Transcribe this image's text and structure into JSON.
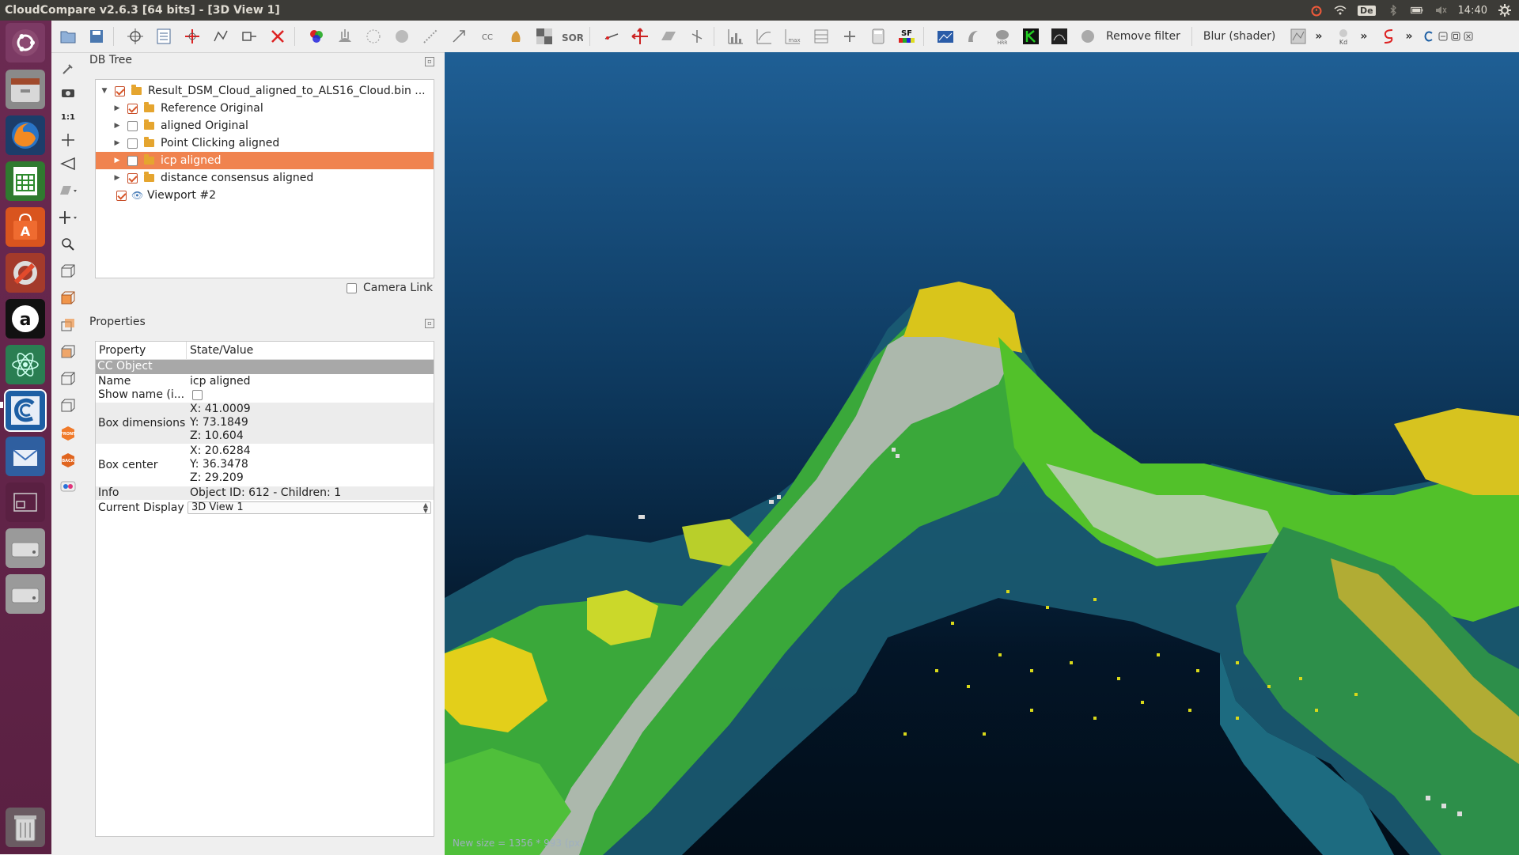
{
  "window": {
    "title": "CloudCompare v2.6.3 [64 bits] - [3D View 1]"
  },
  "system_tray": {
    "keyboard": "De",
    "time": "14:40"
  },
  "launcher": {
    "items": [
      "ubuntu-dash",
      "files",
      "firefox",
      "libreoffice-calc",
      "software-center",
      "system-settings",
      "amazon",
      "atom",
      "cloudcompare",
      "thunderbird",
      "workspaces",
      "drive-1",
      "drive-2",
      "trash"
    ]
  },
  "toolbar": {
    "remove_filter": "Remove filter",
    "blur_shader": "Blur (shader)",
    "more": "»",
    "sf_label": "SF",
    "sor_label": "SOR",
    "kd_label": "Kd"
  },
  "dbtree": {
    "title": "DB Tree",
    "items": [
      {
        "label": "Result_DSM_Cloud_aligned_to_ALS16_Cloud.bin ...",
        "checked": true,
        "level": 0,
        "expanded": true,
        "icon": "folder-icon"
      },
      {
        "label": "Reference Original",
        "checked": true,
        "level": 1,
        "icon": "folder-icon"
      },
      {
        "label": "aligned Original",
        "checked": false,
        "level": 1,
        "icon": "folder-icon"
      },
      {
        "label": "Point Clicking aligned",
        "checked": false,
        "level": 1,
        "icon": "folder-icon"
      },
      {
        "label": "icp aligned",
        "checked": false,
        "level": 1,
        "icon": "folder-icon",
        "selected": true
      },
      {
        "label": "distance consensus aligned",
        "checked": true,
        "level": 1,
        "icon": "folder-icon"
      },
      {
        "label": "Viewport #2",
        "checked": true,
        "level": 0,
        "icon": "eye-icon"
      }
    ],
    "camera_link": "Camera Link"
  },
  "properties": {
    "title": "Properties",
    "col_property": "Property",
    "col_value": "State/Value",
    "section": "CC Object",
    "name_key": "Name",
    "name_val": "icp aligned",
    "show_name_key": "Show name (i...",
    "box_dim_key": "Box dimensions",
    "box_dim": {
      "x": "X: 41.0009",
      "y": "Y: 73.1849",
      "z": "Z: 10.604"
    },
    "box_center_key": "Box center",
    "box_center": {
      "x": "X: 20.6284",
      "y": "Y: 36.3478",
      "z": "Z: 29.209"
    },
    "info_key": "Info",
    "info_val": "Object ID: 612 - Children: 1",
    "display_key": "Current Display",
    "display_val": "3D View 1"
  },
  "view3d": {
    "status": "New size = 1356 * 993 (px)",
    "colors": {
      "sky_top": "#1f5f95",
      "ground": "#031527",
      "green": "#46c21f",
      "yellow": "#e6d21a",
      "grey": "#c8c8c8"
    }
  },
  "colors": {
    "selection": "#f0834f",
    "launcher": "#5e2347",
    "topbar": "#3c3b37"
  }
}
